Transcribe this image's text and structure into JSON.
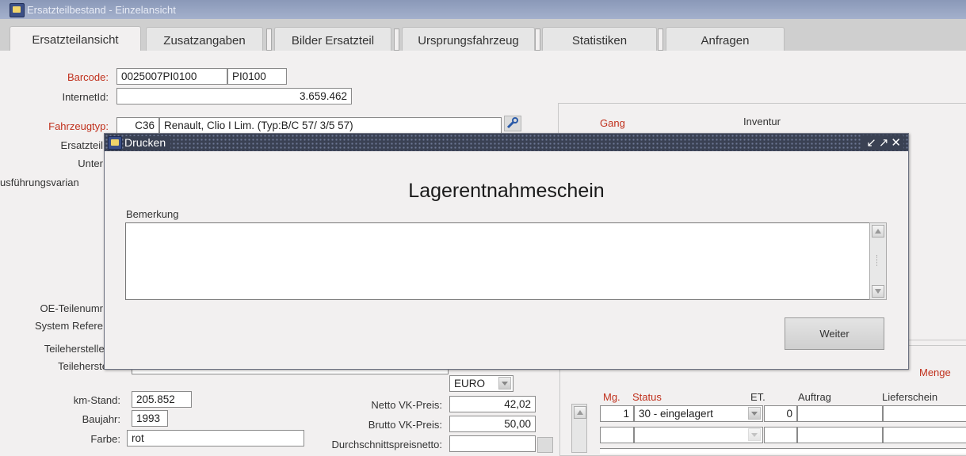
{
  "window": {
    "title": "Ersatzteilbestand - Einzelansicht"
  },
  "tabs": [
    {
      "label": "Ersatzteilansicht"
    },
    {
      "label": "Zusatzangaben"
    },
    {
      "label": "Bilder Ersatzteil"
    },
    {
      "label": "Ursprungsfahrzeug"
    },
    {
      "label": "Statistiken"
    },
    {
      "label": "Anfragen"
    }
  ],
  "form": {
    "barcode_label": "Barcode:",
    "barcode_value": "0025007PI0100",
    "barcode_suffix": "PI0100",
    "internetid_label": "InternetId:",
    "internetid_value": "3.659.462",
    "fahrzeugtyp_label": "Fahrzeugtyp:",
    "fahrzeugtyp_code": "C36",
    "fahrzeugtyp_name": "Renault, Clio I Lim. (Typ:B/C 57/ 3/5 57)",
    "ersatzteil_label": "Ersatzteil",
    "unter_label": "Unter",
    "ausfuehrung_label": "usführungsvarian",
    "oe_label": "OE-Teilenumr",
    "systemref_label": "System Refere",
    "teilehersteller1_label": "Teilehersteller",
    "teilehersteller2_label": "Teileherste",
    "kmstand_label": "km-Stand:",
    "kmstand_value": "205.852",
    "baujahr_label": "Baujahr:",
    "baujahr_value": "1993",
    "farbe_label": "Farbe:",
    "farbe_value": "rot",
    "currency_value": "EURO",
    "netto_label": "Netto VK-Preis:",
    "netto_value": "42,02",
    "brutto_label": "Brutto VK-Preis:",
    "brutto_value": "50,00",
    "durchschnitt_label": "Durchschnittspreisnetto:"
  },
  "right_panel": {
    "gang_label": "Gang",
    "inventur_label": "Inventur",
    "menge_label": "Menge"
  },
  "stock_table": {
    "headers": [
      "Mg.",
      "Status",
      "ET.",
      "Auftrag",
      "Lieferschein"
    ],
    "rows": [
      {
        "mg": "1",
        "status": "30 - eingelagert",
        "et": "0",
        "auftrag": "",
        "lieferschein": ""
      },
      {
        "mg": "",
        "status": "",
        "et": "",
        "auftrag": "",
        "lieferschein": ""
      }
    ]
  },
  "dialog": {
    "title": "Drucken",
    "controls": "↙↗✕",
    "heading": "Lagerentnahmeschein",
    "remark_label": "Bemerkung",
    "remark_value": "",
    "continue_label": "Weiter"
  },
  "colors": {
    "required_label": "#c0301c",
    "dialog_titlebar": "#3a4153",
    "window_titlebar": "#8a98b8"
  }
}
